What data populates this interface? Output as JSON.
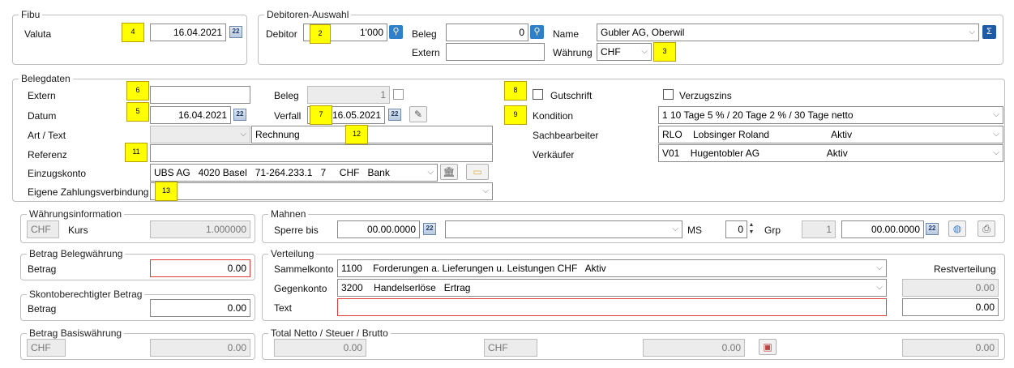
{
  "fibu": {
    "title": "Fibu",
    "valuta_label": "Valuta",
    "valuta_value": "16.04.2021"
  },
  "debitor_auswahl": {
    "title": "Debitoren-Auswahl",
    "debitor_label": "Debitor",
    "debitor_value": "1'000",
    "beleg_label": "Beleg",
    "beleg_value": "0",
    "extern_label": "Extern",
    "extern_value": "",
    "name_label": "Name",
    "name_value": "Gubler AG, Oberwil",
    "waehrung_label": "Währung",
    "waehrung_value": "CHF",
    "sigma_label": "Σ"
  },
  "belegdaten": {
    "title": "Belegdaten",
    "extern_label": "Extern",
    "extern_value": "",
    "beleg_label": "Beleg",
    "beleg_value": "1",
    "datum_label": "Datum",
    "datum_value": "16.04.2021",
    "verfall_label": "Verfall",
    "verfall_value": "16.05.2021",
    "art_label": "Art / Text",
    "art_value": "",
    "text_value": "Rechnung",
    "referenz_label": "Referenz",
    "referenz_value": "",
    "einzugskonto_label": "Einzugskonto",
    "einzugskonto_value": "UBS AG   4020 Basel   71-264.233.1   7     CHF   Bank",
    "eigene_label": "Eigene Zahlungsverbindung",
    "eigene_value": "",
    "gutschrift_label": "Gutschrift",
    "verzugszins_label": "Verzugszins",
    "kondition_label": "Kondition",
    "kondition_value": "1    10 Tage 5 % / 20 Tage 2 % / 30 Tage netto",
    "sachbearbeiter_label": "Sachbearbeiter",
    "sachbearbeiter_value": "RLO    Lobsinger Roland                       Aktiv",
    "verkaeufer_label": "Verkäufer",
    "verkaeufer_value": "V01    Hugentobler AG                         Aktiv"
  },
  "waehrungsinfo": {
    "title": "Währungsinformation",
    "currency": "CHF",
    "kurs_label": "Kurs",
    "kurs_value": "1.000000"
  },
  "mahnen": {
    "title": "Mahnen",
    "sperre_label": "Sperre bis",
    "sperre_value": "00.00.0000",
    "sperre_dropdown": "",
    "ms_label": "MS",
    "ms_value": "0",
    "grp_label": "Grp",
    "grp_value": "1",
    "date2_value": "00.00.0000"
  },
  "betrag_beleg": {
    "title": "Betrag Belegwährung",
    "betrag_label": "Betrag",
    "betrag_value": "0.00"
  },
  "skonto": {
    "title": "Skontoberechtigter Betrag",
    "betrag_label": "Betrag",
    "betrag_value": "0.00"
  },
  "verteilung": {
    "title": "Verteilung",
    "sammel_label": "Sammelkonto",
    "sammel_value": "1100    Forderungen a. Lieferungen u. Leistungen CHF   Aktiv",
    "gegen_label": "Gegenkonto",
    "gegen_value": "3200    Handelserlöse   Ertrag",
    "text_label": "Text",
    "text_value": "",
    "rest_label": "Restverteilung",
    "rest_value": "0.00",
    "total_value": "0.00"
  },
  "basis": {
    "title": "Betrag Basiswährung",
    "currency": "CHF",
    "value": "0.00"
  },
  "total": {
    "title": "Total Netto / Steuer / Brutto",
    "netto": "0.00",
    "currency": "CHF",
    "steuer": "0.00",
    "brutto": "0.00"
  },
  "markers": {
    "m2": "2",
    "m3": "3",
    "m4": "4",
    "m5": "5",
    "m6": "6",
    "m7": "7",
    "m8": "8",
    "m9": "9",
    "m11": "11",
    "m12": "12",
    "m13": "13"
  },
  "icons": {
    "calendar": "22",
    "search": "⚲",
    "chevron": "⌵"
  }
}
